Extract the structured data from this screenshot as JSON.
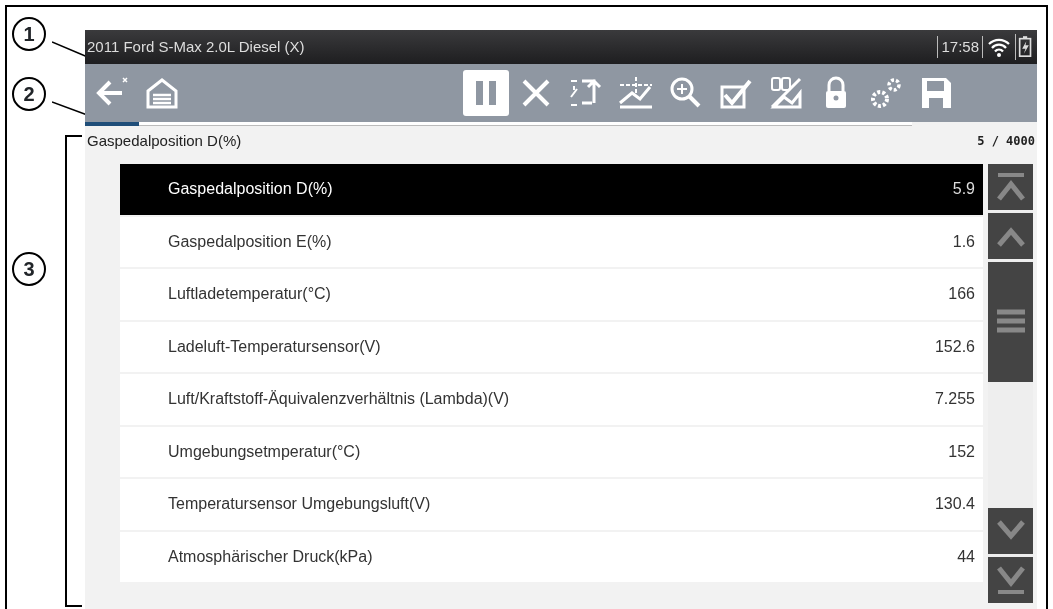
{
  "callouts": [
    "1",
    "2",
    "3"
  ],
  "status_bar": {
    "title": "2011 Ford S-Max 2.0L Diesel (X)",
    "time": "17:58"
  },
  "toolbar": [
    {
      "kind": "back",
      "selected": false
    },
    {
      "kind": "home",
      "selected": false
    },
    {
      "kind": "pause",
      "selected": true
    },
    {
      "kind": "clear",
      "selected": false
    },
    {
      "kind": "sort",
      "selected": false
    },
    {
      "kind": "graph",
      "selected": false
    },
    {
      "kind": "zoom",
      "selected": false
    },
    {
      "kind": "check",
      "selected": false
    },
    {
      "kind": "digits",
      "selected": false
    },
    {
      "kind": "lock",
      "selected": false
    },
    {
      "kind": "gears",
      "selected": false
    },
    {
      "kind": "save",
      "selected": false
    }
  ],
  "position": {
    "level": 0.065
  },
  "header": {
    "title": "Gaspedalposition D(%)",
    "count": "5 / 4000"
  },
  "rows": [
    {
      "name": "Gaspedalposition D(%)",
      "value": "5.9",
      "selected": true
    },
    {
      "name": "Gaspedalposition E(%)",
      "value": "1.6",
      "selected": false
    },
    {
      "name": "Luftladetemperatur(°C)",
      "value": "166",
      "selected": false
    },
    {
      "name": "Ladeluft-Temperatursensor(V)",
      "value": "152.6",
      "selected": false
    },
    {
      "name": "Luft/Kraftstoff-Äquivalenzverhältnis (Lambda)(V)",
      "value": "7.255",
      "selected": false
    },
    {
      "name": "Umgebungsetmperatur(°C)",
      "value": "152",
      "selected": false
    },
    {
      "name": "Temperatursensor Umgebungsluft(V)",
      "value": "130.4",
      "selected": false
    },
    {
      "name": "Atmosphärischer Druck(kPa)",
      "value": "44",
      "selected": false
    }
  ]
}
